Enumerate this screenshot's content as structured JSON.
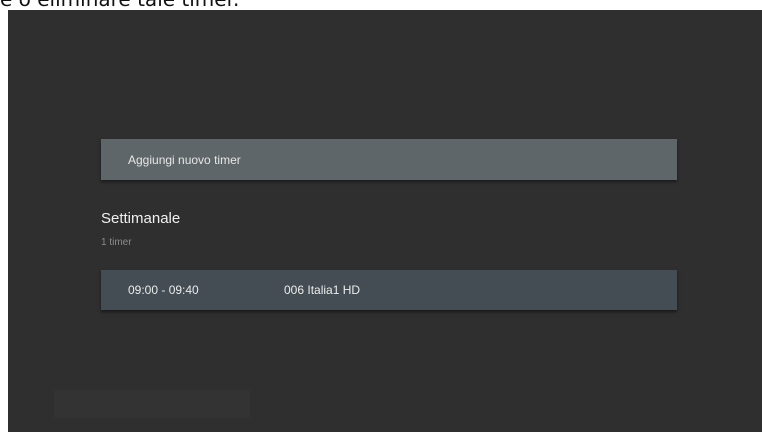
{
  "caption": {
    "text": "e o eliminare tale timer."
  },
  "screen": {
    "add_timer_label": "Aggiungi nuovo timer",
    "section": {
      "title": "Settimanale",
      "subtitle": "1 timer"
    },
    "timers": [
      {
        "time": "09:00 - 09:40",
        "channel": "006 Italia1 HD"
      }
    ]
  },
  "colors": {
    "screen_bg": "#2f2f2f",
    "add_button_bg": "#5f6669",
    "timer_row_bg": "#434d53"
  }
}
